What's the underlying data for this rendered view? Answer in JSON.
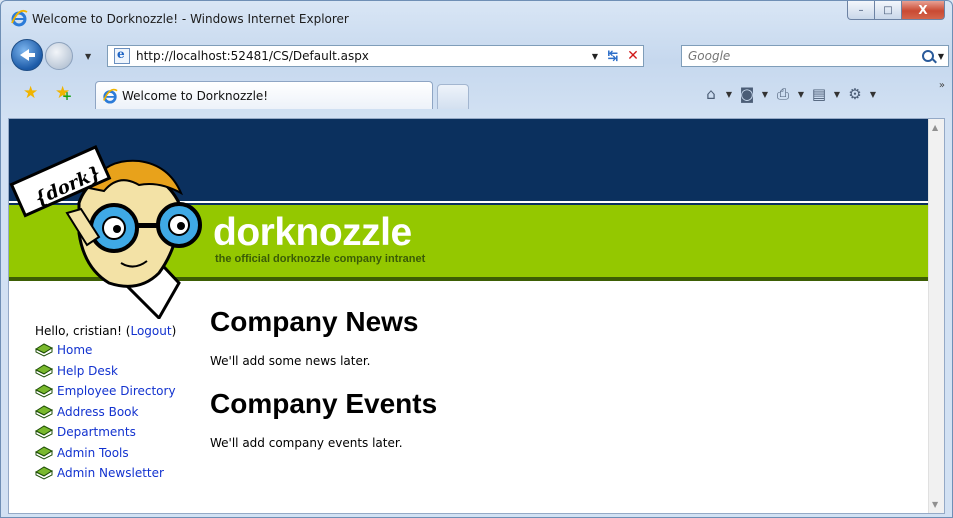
{
  "window": {
    "title": "Welcome to Dorknozzle! - Windows Internet Explorer",
    "controls": {
      "minimize": "–",
      "maximize": "□",
      "close": "X"
    }
  },
  "address_bar": {
    "url": "http://localhost:52481/CS/Default.aspx",
    "refresh_glyph": "↹",
    "stop_glyph": "✕"
  },
  "search": {
    "placeholder": "Google"
  },
  "tab": {
    "label": "Welcome to Dorknozzle!"
  },
  "toolbar": {
    "icons": [
      "home-icon",
      "feeds-icon",
      "print-icon",
      "page-icon",
      "tools-icon"
    ],
    "glyphs": {
      "home": "⌂",
      "feeds": "◙",
      "print": "⎙",
      "page": "▤",
      "tools": "⚙"
    },
    "more": "»"
  },
  "site": {
    "brand": "dorknozzle",
    "tagline": "the official dorknozzle company intranet",
    "mascot_sign": "{dork}",
    "colors": {
      "navy": "#0b305e",
      "green": "#94c800",
      "link": "#1232cf"
    }
  },
  "sidebar": {
    "greeting": "Hello, cristian!",
    "logout_open": " (",
    "logout": "Logout",
    "logout_close": ")",
    "items": [
      {
        "label": "Home"
      },
      {
        "label": "Help Desk"
      },
      {
        "label": "Employee Directory"
      },
      {
        "label": "Address Book"
      },
      {
        "label": "Departments"
      },
      {
        "label": "Admin Tools"
      },
      {
        "label": "Admin Newsletter"
      }
    ]
  },
  "main": {
    "news_heading": "Company News",
    "news_text": "We'll add some news later.",
    "events_heading": "Company Events",
    "events_text": "We'll add company events later."
  }
}
